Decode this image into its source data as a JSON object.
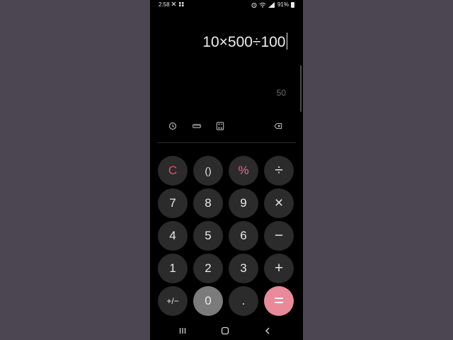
{
  "status_bar": {
    "time": "2:58",
    "left_icons": "✕ ▪▪",
    "battery_percent": "91%"
  },
  "display": {
    "expression": "10×500÷100",
    "result": "50"
  },
  "tools": [
    {
      "name": "history-icon"
    },
    {
      "name": "ruler-icon"
    },
    {
      "name": "calculator-mode-icon"
    },
    {
      "name": "backspace-icon"
    }
  ],
  "keypad": {
    "row1": [
      "C",
      "()",
      "%",
      "÷"
    ],
    "row2": [
      "7",
      "8",
      "9",
      "×"
    ],
    "row3": [
      "4",
      "5",
      "6",
      "−"
    ],
    "row4": [
      "1",
      "2",
      "3",
      "+"
    ],
    "row5": [
      "+/−",
      "0",
      ".",
      "="
    ]
  },
  "colors": {
    "key_background": "#2b2b2b",
    "clear_color": "#e0506a",
    "percent_color": "#e86b8c",
    "equals_background": "#e98a9b",
    "backdrop": "#4b4651"
  },
  "nav_bar": {
    "icons": [
      "recent-apps-icon",
      "home-icon",
      "back-icon"
    ]
  }
}
